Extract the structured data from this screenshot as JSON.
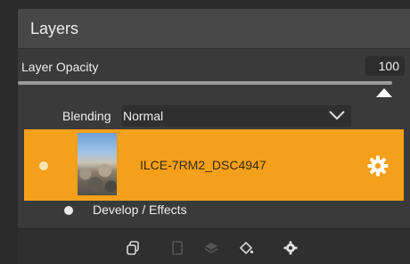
{
  "panel": {
    "title": "Layers"
  },
  "opacity": {
    "label": "Layer Opacity",
    "value": "100",
    "level_percent": 100
  },
  "blending": {
    "label": "Blending",
    "value": "Normal"
  },
  "layer": {
    "name": "ILCE-7RM2_DSC4947",
    "accent_color": "#f5a01a"
  },
  "sublayer": {
    "label": "Develop / Effects"
  },
  "toolbar": {
    "icons": [
      "duplicate-icon",
      "new-layer-icon",
      "stack-icon",
      "fill-bucket-icon",
      "gear-icon"
    ]
  }
}
